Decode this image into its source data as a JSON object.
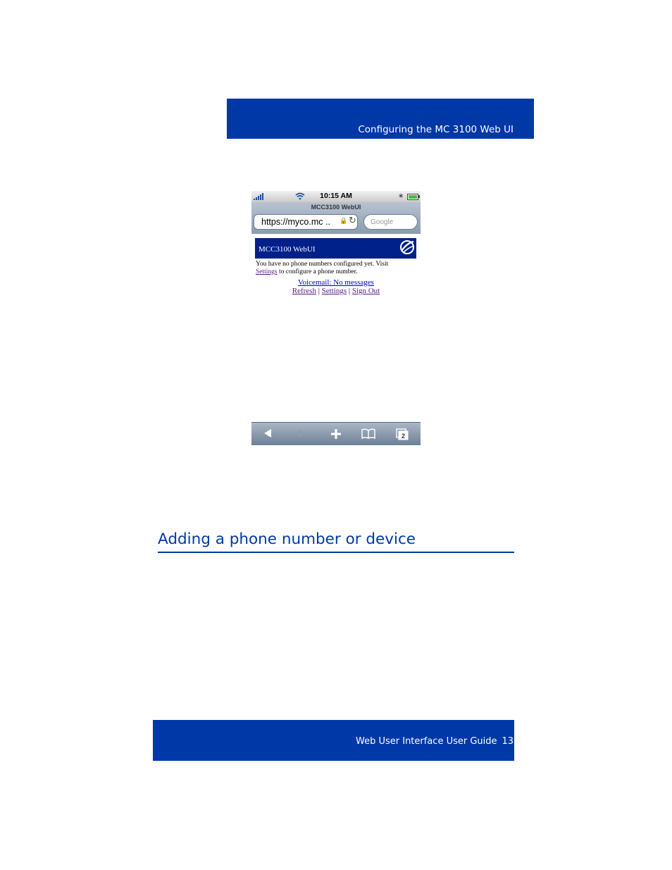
{
  "header": {
    "title": "Configuring the MC 3100 Web UI"
  },
  "phone": {
    "status_bar": {
      "time": "10:15 AM"
    },
    "browser": {
      "page_title": "MCC3100 WebUI",
      "url": "https://myco.mc  ..",
      "search_placeholder": "Google"
    },
    "webui": {
      "title": "MCC3100 WebUI",
      "message_line1": "You have no phone numbers configured yet.  Visit",
      "message_link": "Settings",
      "message_line2": " to configure a phone number.",
      "voicemail": "Voicemail: No messages",
      "links": {
        "refresh": "Refresh",
        "settings": "Settings",
        "sign_out": "Sign Out",
        "separator": " | "
      }
    },
    "toolbar": {
      "tabs_count": "2"
    }
  },
  "section": {
    "heading": "Adding a phone number or device"
  },
  "footer": {
    "guide_title": "Web User Interface User Guide",
    "page_number": "13"
  },
  "colors": {
    "brand_blue": "#0038a8"
  }
}
